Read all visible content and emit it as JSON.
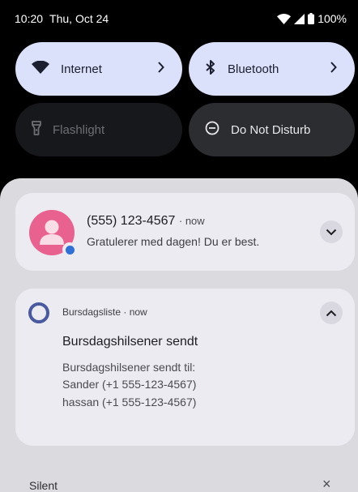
{
  "status_bar": {
    "time": "10:20",
    "date": "Thu, Oct 24",
    "battery": "100%",
    "icons": [
      "wifi-icon",
      "cell-signal-icon",
      "battery-icon"
    ]
  },
  "quick_settings": {
    "tiles": [
      {
        "label": "Internet",
        "icon": "wifi-icon",
        "state": "on"
      },
      {
        "label": "Bluetooth",
        "icon": "bluetooth-icon",
        "state": "on"
      },
      {
        "label": "Flashlight",
        "icon": "flashlight-icon",
        "state": "off"
      },
      {
        "label": "Do Not Disturb",
        "icon": "dnd-icon",
        "state": "off"
      }
    ]
  },
  "notifications": [
    {
      "title": "(555) 123-4567",
      "time": "· now",
      "body": "Gratulerer med dagen! Du er best.",
      "icon": "avatar-icon"
    },
    {
      "app_name": "Bursdagsliste · now",
      "title": "Bursdagshilsener sendt",
      "lines": [
        "Bursdagshilsener sendt til:",
        "Sander (+1 555-123-4567)",
        "hassan (+1 555-123-4567)"
      ],
      "icon": "app-ring-icon"
    }
  ],
  "silent_section": {
    "label": "Silent",
    "clear_label": "×"
  },
  "colors": {
    "tile_on": "#dbe1fb",
    "tile_off": "#16181c",
    "tile_dnd": "#2c2d31",
    "shade": "#dadadf",
    "card": "#ecebf1",
    "avatar": "#e9618e",
    "app_icon": "#4a5aa0"
  }
}
